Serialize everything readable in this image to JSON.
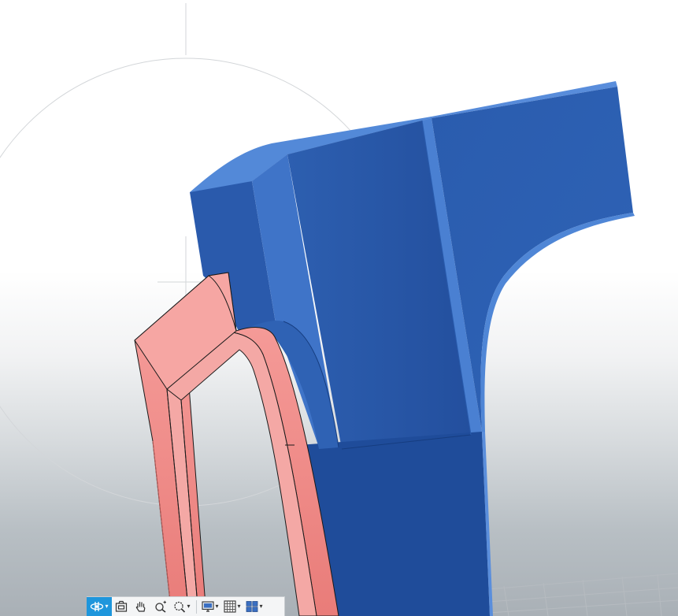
{
  "viewport": {
    "background_top": "#ffffff",
    "background_bottom": "#a9b0b6",
    "model_color": "#2451a0",
    "model_highlight": "#4f86d6",
    "selected_color": "#f29390",
    "selected_outline": "#1a1a1a",
    "grid_color": "#c4c8cc"
  },
  "navigation_bar": {
    "tools": [
      {
        "name": "orbit",
        "icon": "orbit-icon",
        "active": true,
        "has_menu": true
      },
      {
        "name": "look-at",
        "icon": "look-at-icon",
        "active": false,
        "has_menu": false
      },
      {
        "name": "pan",
        "icon": "pan-hand-icon",
        "active": false,
        "has_menu": false
      },
      {
        "name": "zoom",
        "icon": "zoom-icon",
        "active": false,
        "has_menu": false
      },
      {
        "name": "fit",
        "icon": "zoom-fit-icon",
        "active": false,
        "has_menu": true
      },
      {
        "name": "display-settings",
        "icon": "display-settings-icon",
        "active": false,
        "has_menu": true
      },
      {
        "name": "grid-and-snaps",
        "icon": "grid-icon",
        "active": false,
        "has_menu": true
      },
      {
        "name": "viewports",
        "icon": "viewports-icon",
        "active": false,
        "has_menu": true
      }
    ],
    "active_color": "#1e96dc"
  }
}
